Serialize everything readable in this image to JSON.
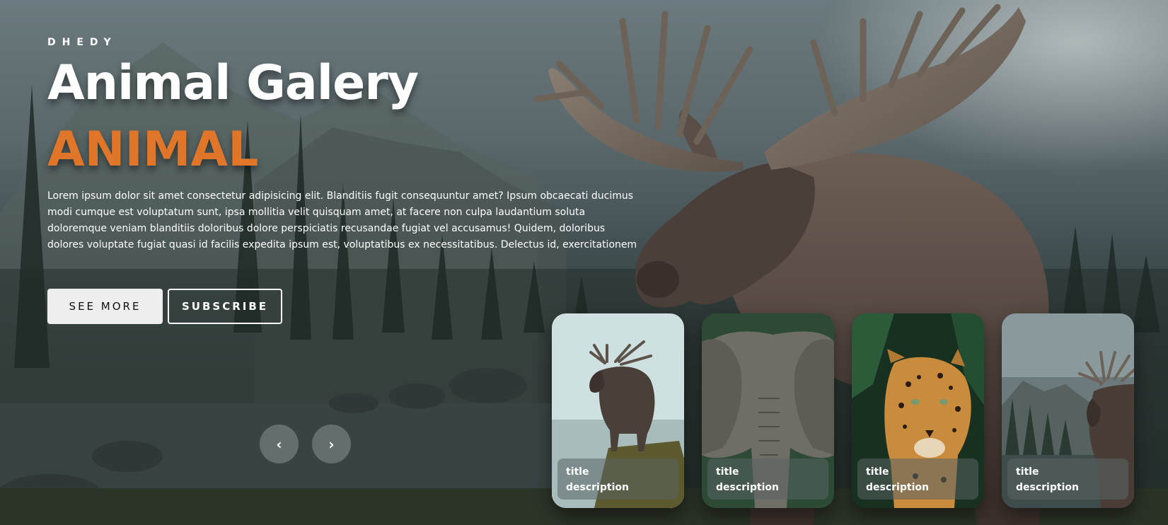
{
  "hero": {
    "brand": "DHEDY",
    "title": "Animal Galery",
    "topic": "ANIMAL",
    "description": "Lorem ipsum dolor sit amet consectetur adipisicing elit. Blanditiis fugit consequuntur amet? Ipsum obcaecati ducimus modi cumque est voluptatum sunt, ipsa mollitia velit quisquam amet, at facere non culpa laudantium soluta doloremque veniam blanditiis doloribus dolore perspiciatis recusandae fugiat vel accusamus! Quidem, doloribus dolores voluptate fugiat quasi id facilis expedita ipsum est, voluptatibus ex necessitatibus. Delectus id, exercitationem",
    "see_more_label": "SEE MORE",
    "subscribe_label": "SUBSCRIBE"
  },
  "arrows": {
    "prev_icon": "chevron-left-icon",
    "prev_glyph": "‹",
    "next_icon": "chevron-right-icon",
    "next_glyph": "›"
  },
  "thumbnails": [
    {
      "animal": "moose",
      "title": "title",
      "description": "description"
    },
    {
      "animal": "elephant",
      "title": "title",
      "description": "description"
    },
    {
      "animal": "leopard",
      "title": "title",
      "description": "description"
    },
    {
      "animal": "moose",
      "title": "title",
      "description": "description"
    }
  ],
  "colors": {
    "accent": "#e0762a",
    "text": "#ffffff",
    "button_light": "#eeeeee"
  }
}
